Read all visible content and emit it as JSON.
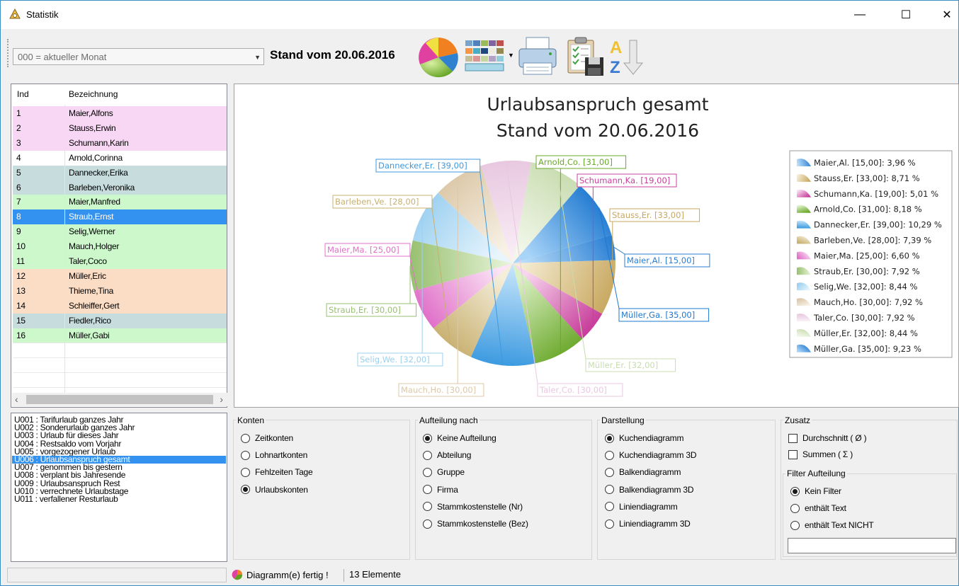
{
  "window": {
    "title": "Statistik",
    "minimize": "—",
    "maximize": "☐",
    "close": "✕"
  },
  "toolbar": {
    "period_value": "000 = aktueller Monat",
    "stand_label": "Stand vom 20.06.2016"
  },
  "grid": {
    "columns": [
      "Ind",
      "Bezeichnung"
    ],
    "rows": [
      {
        "ind": "1",
        "name": "Maier,Alfons",
        "color": "#f8d7f4"
      },
      {
        "ind": "2",
        "name": "Stauss,Erwin",
        "color": "#f8d7f4"
      },
      {
        "ind": "3",
        "name": "Schumann,Karin",
        "color": "#f8d7f4"
      },
      {
        "ind": "4",
        "name": "Arnold,Corinna",
        "color": "#ffffff"
      },
      {
        "ind": "5",
        "name": "Dannecker,Erika",
        "color": "#c6dcdd"
      },
      {
        "ind": "6",
        "name": "Barleben,Veronika",
        "color": "#c6dcdd"
      },
      {
        "ind": "7",
        "name": "Maier,Manfred",
        "color": "#ccf8cc"
      },
      {
        "ind": "8",
        "name": "Straub,Ernst",
        "color": "#3392f0",
        "selected": true
      },
      {
        "ind": "9",
        "name": "Selig,Werner",
        "color": "#ccf8cc"
      },
      {
        "ind": "10",
        "name": "Mauch,Holger",
        "color": "#ccf8cc"
      },
      {
        "ind": "11",
        "name": "Taler,Coco",
        "color": "#ccf8cc"
      },
      {
        "ind": "12",
        "name": "Müller,Eric",
        "color": "#fbdcc4"
      },
      {
        "ind": "13",
        "name": "Thieme,Tina",
        "color": "#fbdcc4"
      },
      {
        "ind": "14",
        "name": "Schleiffer,Gert",
        "color": "#fbdcc4"
      },
      {
        "ind": "15",
        "name": "Fiedler,Rico",
        "color": "#c6dcdd"
      },
      {
        "ind": "16",
        "name": "Müller,Gabi",
        "color": "#ccf8cc"
      }
    ]
  },
  "chart_data": {
    "type": "pie",
    "title": "Urlaubsanspruch gesamt",
    "subtitle": "Stand vom 20.06.2016",
    "legend_position": "right",
    "slices": [
      {
        "label": "Maier,Al.",
        "value": 15.0,
        "percent": "3,96 %",
        "color": "#2a7fd4",
        "light": "#bfe0fa"
      },
      {
        "label": "Stauss,Er.",
        "value": 33.0,
        "percent": "8,71 %",
        "color": "#c8a860",
        "light": "#f5ecd2"
      },
      {
        "label": "Schumann,Ka.",
        "value": 19.0,
        "percent": "5,01 %",
        "color": "#c8409c",
        "light": "#f7d6ee"
      },
      {
        "label": "Arnold,Co.",
        "value": 31.0,
        "percent": "8,18 %",
        "color": "#6aa82a",
        "light": "#dcf0c6"
      },
      {
        "label": "Dannecker,Er.",
        "value": 39.0,
        "percent": "10,29 %",
        "color": "#3c9ae0",
        "light": "#c8e6fb"
      },
      {
        "label": "Barleben,Ve.",
        "value": 28.0,
        "percent": "7,39 %",
        "color": "#c8b070",
        "light": "#f4eeda"
      },
      {
        "label": "Maier,Ma.",
        "value": 25.0,
        "percent": "6,60 %",
        "color": "#e070c8",
        "light": "#fae4f5"
      },
      {
        "label": "Straub,Er.",
        "value": 30.0,
        "percent": "7,92 %",
        "color": "#98c070",
        "light": "#eaf5dc"
      },
      {
        "label": "Selig,We.",
        "value": 32.0,
        "percent": "8,44 %",
        "color": "#9cd0f0",
        "light": "#e8f5fd"
      },
      {
        "label": "Mauch,Ho.",
        "value": 30.0,
        "percent": "7,92 %",
        "color": "#dcc8a8",
        "light": "#f7f1e6"
      },
      {
        "label": "Taler,Co.",
        "value": 30.0,
        "percent": "7,92 %",
        "color": "#e8c8e0",
        "light": "#faf0f7"
      },
      {
        "label": "Müller,Er.",
        "value": 32.0,
        "percent": "8,44 %",
        "color": "#c8dcb0",
        "light": "#f2f7ea"
      },
      {
        "label": "Müller,Ga.",
        "value": 35.0,
        "percent": "9,23 %",
        "color": "#1e78d0",
        "light": "#a8d4f8"
      }
    ]
  },
  "urlaub_list": [
    "U001 : Tarifurlaub ganzes Jahr",
    "U002 : Sonderurlaub ganzes Jahr",
    "U003 : Urlaub für dieses Jahr",
    "U004 : Restsaldo vom Vorjahr",
    "U005 : vorgezogener Urlaub",
    "U006 : Urlaubsanspruch gesamt",
    "U007 : genommen bis gestern",
    "U008 : verplant bis Jahresende",
    "U009 : Urlaubsanspruch Rest",
    "U010 : verrechnete Urlaubstage",
    "U011 : verfallener Resturlaub"
  ],
  "urlaub_selected_index": 5,
  "konten": {
    "title": "Konten",
    "options": [
      "Zeitkonten",
      "Lohnartkonten",
      "Fehlzeiten Tage",
      "Urlaubskonten"
    ],
    "selected": 3
  },
  "aufteilung": {
    "title": "Aufteilung nach",
    "options": [
      "Keine Aufteilung",
      "Abteilung",
      "Gruppe",
      "Firma",
      "Stammkostenstelle (Nr)",
      "Stammkostenstelle (Bez)"
    ],
    "selected": 0
  },
  "darstellung": {
    "title": "Darstellung",
    "options": [
      "Kuchendiagramm",
      "Kuchendiagramm 3D",
      "Balkendiagramm",
      "Balkendiagramm 3D",
      "Liniendiagramm",
      "Liniendiagramm 3D"
    ],
    "selected": 0
  },
  "zusatz": {
    "title": "Zusatz",
    "checks": [
      "Durchschnitt ( Ø )",
      "Summen ( Σ )"
    ],
    "filter_title": "Filter Aufteilung",
    "filter_options": [
      "Kein Filter",
      "enthält Text",
      "enthält Text NICHT"
    ],
    "filter_selected": 0,
    "filter_text": ""
  },
  "status": {
    "message": "Diagramm(e) fertig !",
    "count": "13 Elemente"
  }
}
